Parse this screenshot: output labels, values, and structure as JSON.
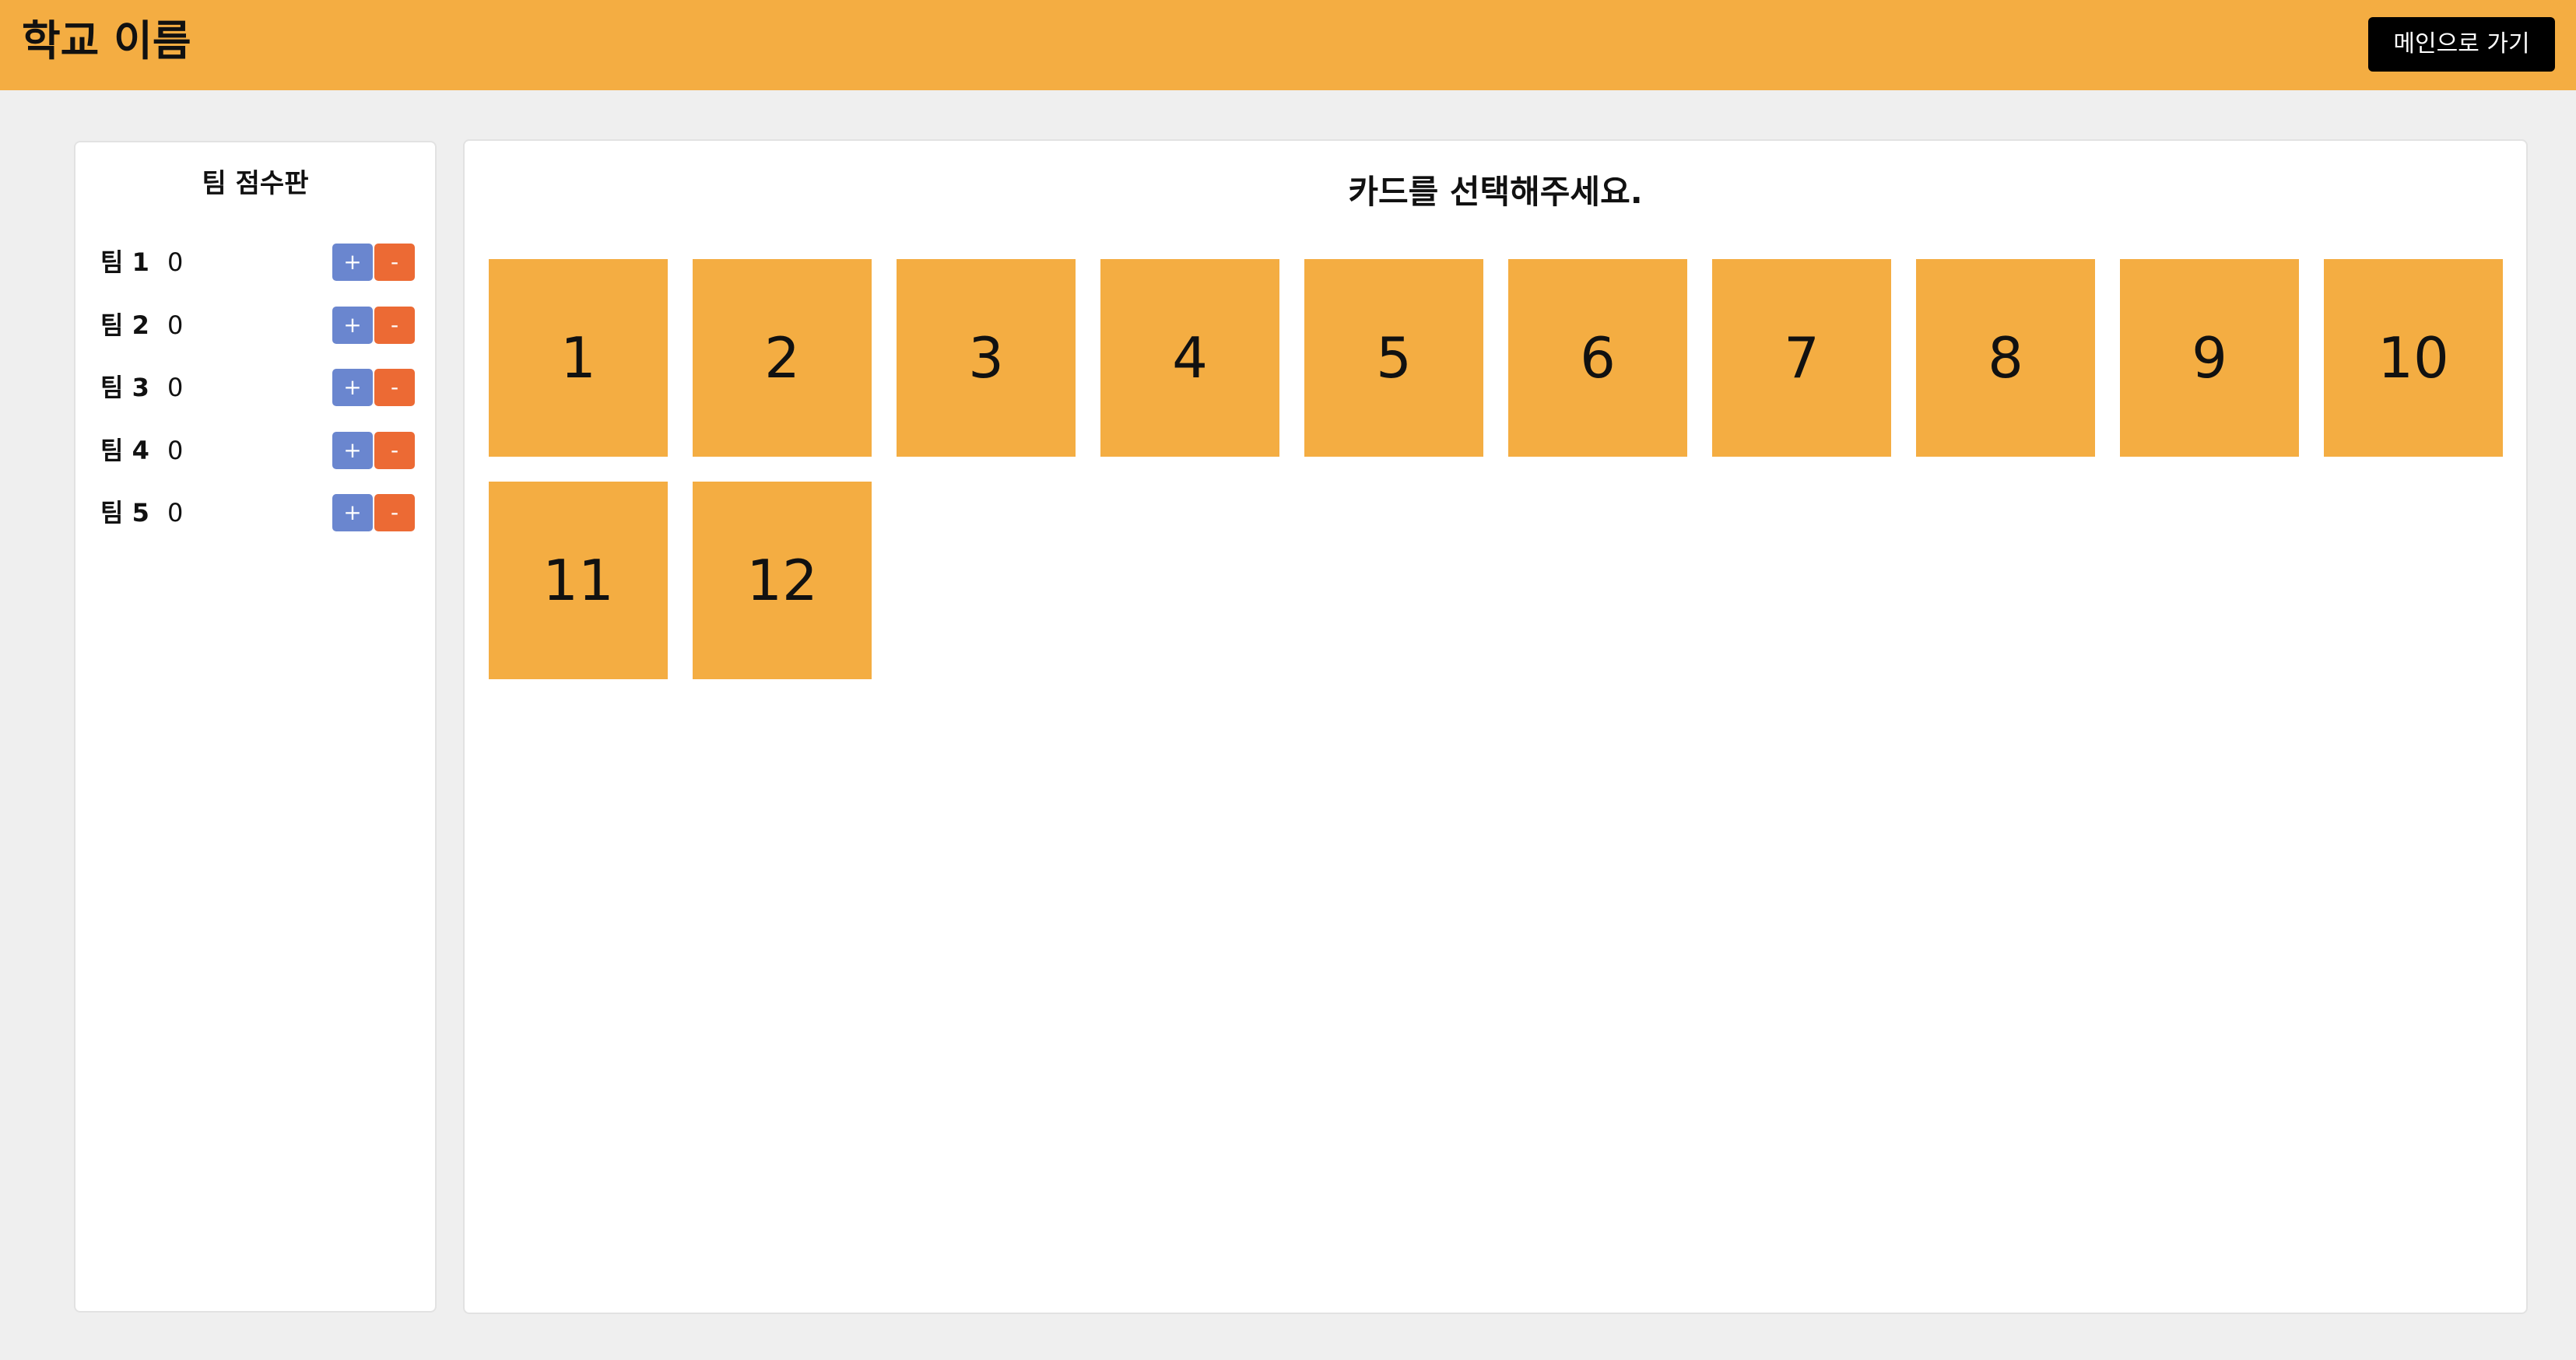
{
  "header": {
    "title": "학교 이름",
    "main_button": "메인으로 가기"
  },
  "scoreboard": {
    "title": "팀 점수판",
    "teams": [
      {
        "name": "팀 1",
        "score": "0",
        "plus": "+",
        "minus": "-"
      },
      {
        "name": "팀 2",
        "score": "0",
        "plus": "+",
        "minus": "-"
      },
      {
        "name": "팀 3",
        "score": "0",
        "plus": "+",
        "minus": "-"
      },
      {
        "name": "팀 4",
        "score": "0",
        "plus": "+",
        "minus": "-"
      },
      {
        "name": "팀 5",
        "score": "0",
        "plus": "+",
        "minus": "-"
      }
    ]
  },
  "board": {
    "prompt": "카드를 선택해주세요.",
    "cards": [
      "1",
      "2",
      "3",
      "4",
      "5",
      "6",
      "7",
      "8",
      "9",
      "10",
      "11",
      "12"
    ]
  },
  "colors": {
    "accent": "#f4ad42",
    "plus_button": "#6a86cf",
    "minus_button": "#ec6a34",
    "background": "#efefef"
  }
}
